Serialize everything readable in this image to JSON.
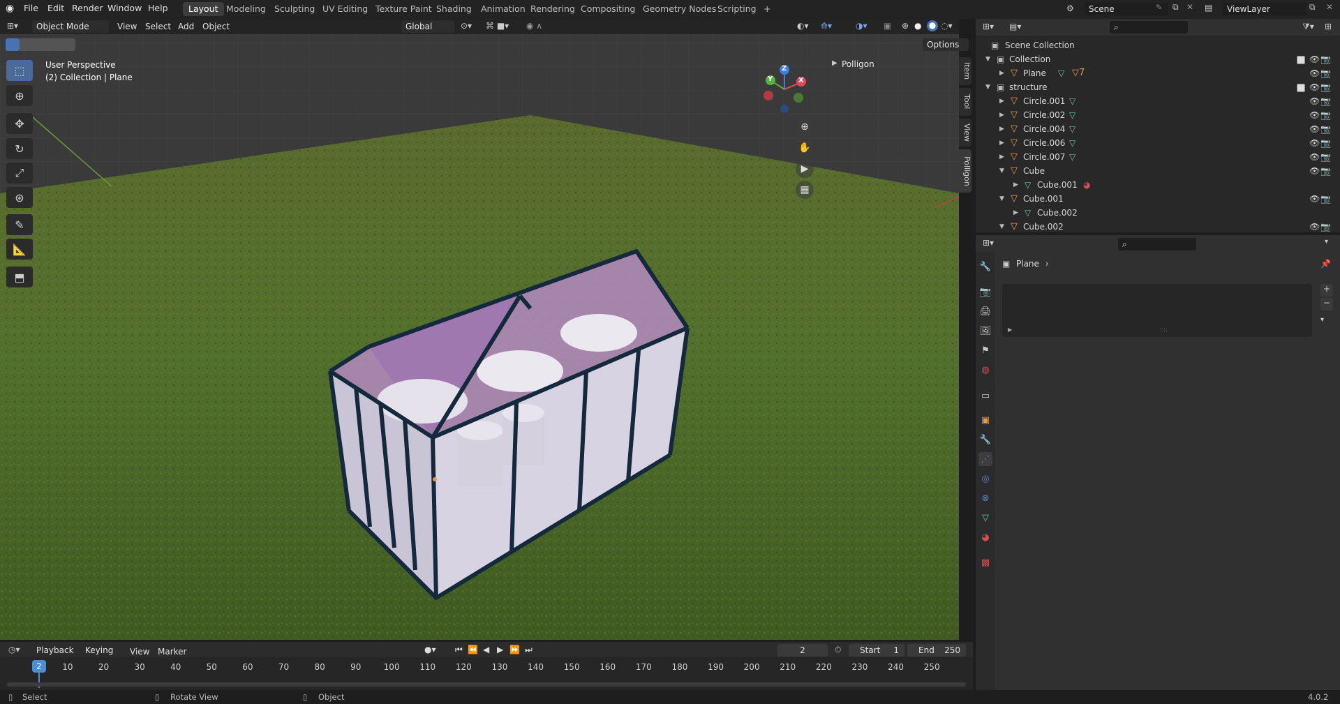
{
  "menu": [
    "File",
    "Edit",
    "Render",
    "Window",
    "Help"
  ],
  "workspaces": [
    "Layout",
    "Modeling",
    "Sculpting",
    "UV Editing",
    "Texture Paint",
    "Shading",
    "Animation",
    "Rendering",
    "Compositing",
    "Geometry Nodes",
    "Scripting"
  ],
  "workspace_add": "+",
  "scene": {
    "name": "Scene",
    "view_layer": "ViewLayer"
  },
  "viewport_header": {
    "mode": "Object Mode",
    "menus": [
      "View",
      "Select",
      "Add",
      "Object"
    ],
    "transform_orientation": "Global",
    "options": "Options"
  },
  "viewport_overlay": {
    "perspective": "User Perspective",
    "collection_info": "(2) Collection | Plane",
    "n_panel_header": "Polligon",
    "axes": {
      "x": "X",
      "y": "Y",
      "z": "Z"
    }
  },
  "side_tabs": [
    "Item",
    "Tool",
    "View",
    "Polligon"
  ],
  "outliner": {
    "root": "Scene Collection",
    "rows": [
      {
        "name": "Collection",
        "type": "collection",
        "indent": 0,
        "expanded": true,
        "checkbox": true
      },
      {
        "name": "Plane",
        "type": "object",
        "indent": 1,
        "expanded": false,
        "badge": "7"
      },
      {
        "name": "structure",
        "type": "collection",
        "indent": 0,
        "expanded": true,
        "checkbox": true
      },
      {
        "name": "Circle.001",
        "type": "object",
        "indent": 1,
        "expanded": false
      },
      {
        "name": "Circle.002",
        "type": "object",
        "indent": 1,
        "expanded": false
      },
      {
        "name": "Circle.004",
        "type": "object",
        "indent": 1,
        "expanded": false
      },
      {
        "name": "Circle.006",
        "type": "object",
        "indent": 1,
        "expanded": false
      },
      {
        "name": "Circle.007",
        "type": "object",
        "indent": 1,
        "expanded": false
      },
      {
        "name": "Cube",
        "type": "object",
        "indent": 1,
        "expanded": true
      },
      {
        "name": "Cube.001",
        "type": "mesh",
        "indent": 2,
        "expanded": false
      },
      {
        "name": "Cube.001",
        "type": "object",
        "indent": 1,
        "expanded": true
      },
      {
        "name": "Cube.002",
        "type": "mesh",
        "indent": 2,
        "expanded": false
      },
      {
        "name": "Cube.002",
        "type": "object",
        "indent": 1,
        "expanded": true
      }
    ]
  },
  "properties": {
    "breadcrumb": "Plane"
  },
  "timeline": {
    "menus": [
      "Playback",
      "Keying",
      "View",
      "Marker"
    ],
    "current_frame": "2",
    "start_label": "Start",
    "start": "1",
    "end_label": "End",
    "end": "250",
    "ticks": [
      "10",
      "20",
      "30",
      "40",
      "50",
      "60",
      "70",
      "80",
      "90",
      "100",
      "110",
      "120",
      "130",
      "140",
      "150",
      "160",
      "170",
      "180",
      "190",
      "200",
      "210",
      "220",
      "230",
      "240",
      "250"
    ]
  },
  "status": {
    "left": "Select",
    "middle": "Rotate View",
    "right": "Object",
    "version": "4.0.2"
  },
  "colors": {
    "accent": "#4772b3",
    "object_icon": "#e69a4c",
    "mesh_icon": "#5fd0a0",
    "frame_indicator": "#4a8fd6"
  }
}
